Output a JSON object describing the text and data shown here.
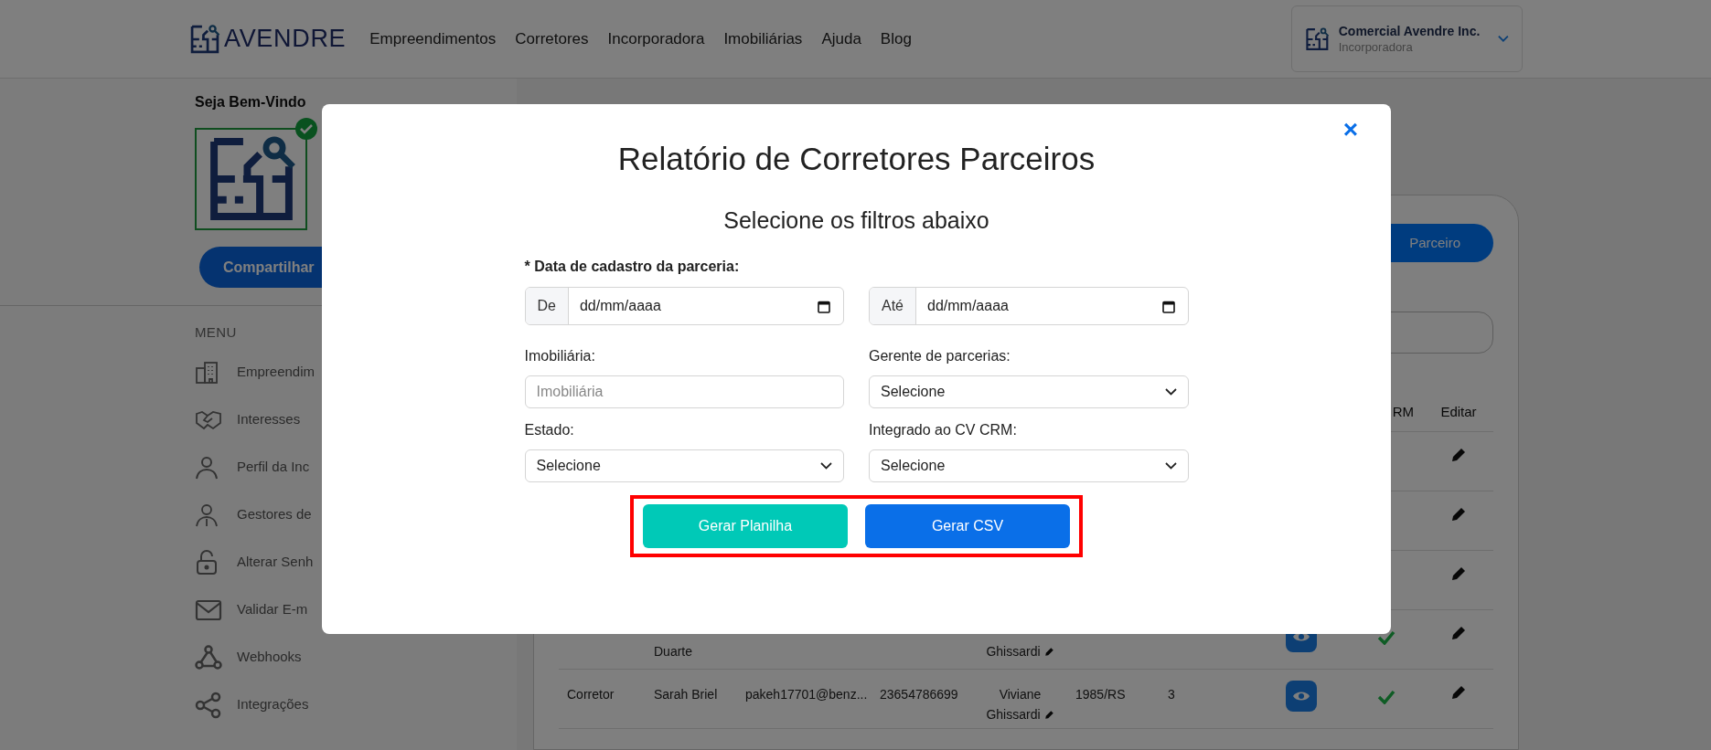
{
  "header": {
    "logo": "AVENDRE",
    "nav": [
      {
        "label": "Empreendimentos"
      },
      {
        "label": "Corretores"
      },
      {
        "label": "Incorporadora"
      },
      {
        "label": "Imobiliárias"
      },
      {
        "label": "Ajuda"
      },
      {
        "label": "Blog"
      }
    ],
    "account": {
      "name": "Comercial Avendre Inc.",
      "role": "Incorporadora"
    }
  },
  "sidebar": {
    "welcome": "Seja Bem-Vindo",
    "share_button": "Compartilhar",
    "menu_title": "MENU",
    "items": [
      {
        "label": "Empreendim"
      },
      {
        "label": "Interesses"
      },
      {
        "label": "Perfil da Inc"
      },
      {
        "label": "Gestores de"
      },
      {
        "label": "Alterar Senh"
      },
      {
        "label": "Validar E-m"
      },
      {
        "label": "Webhooks"
      },
      {
        "label": "Integrações"
      }
    ]
  },
  "main": {
    "add_button": "Parceiro",
    "table": {
      "header": {
        "column_9": "RM",
        "column_10": "Editar"
      },
      "rows": [
        {
          "editable": true
        },
        {
          "editable": true
        },
        {
          "editable": true
        },
        {
          "continued": true,
          "column_2": "Duarte",
          "column_5": [
            "Ghissardi"
          ],
          "manager_edit": true,
          "view_button": true,
          "crm_check": true,
          "editable": true
        },
        {
          "continued": false,
          "column_1": "Corretor",
          "column_2": "Sarah Briel",
          "column_3": "pakeh17701@benz...",
          "column_4": "23654786699",
          "column_5": [
            "Viviane",
            "Ghissardi"
          ],
          "manager_edit": true,
          "column_6": "1985/RS",
          "column_7": "3",
          "view_button": true,
          "crm_check": true,
          "editable": true
        }
      ]
    }
  },
  "modal": {
    "title": "Relatório de Corretores Parceiros",
    "subtitle": "Selecione os filtros abaixo",
    "close": "×",
    "date_label": "* Data de cadastro da parceria:",
    "date_from": {
      "addon": "De",
      "placeholder": "dd/mm/aaaa"
    },
    "date_to": {
      "addon": "Até",
      "placeholder": "dd/mm/aaaa"
    },
    "fields": [
      {
        "label": "Imobiliária:",
        "kind": "text",
        "placeholder": "Imobiliária"
      },
      {
        "label": "Gerente de parcerias:",
        "kind": "select",
        "value": "Selecione"
      },
      {
        "label": "Estado:",
        "kind": "select",
        "value": "Selecione"
      },
      {
        "label": "Integrado ao CV CRM:",
        "kind": "select",
        "value": "Selecione"
      }
    ],
    "buttons_highlighted": true,
    "buttons": [
      {
        "label": "Gerar Planilha",
        "kind": "secondary"
      },
      {
        "label": "Gerar CSV",
        "kind": "primary"
      }
    ]
  }
}
